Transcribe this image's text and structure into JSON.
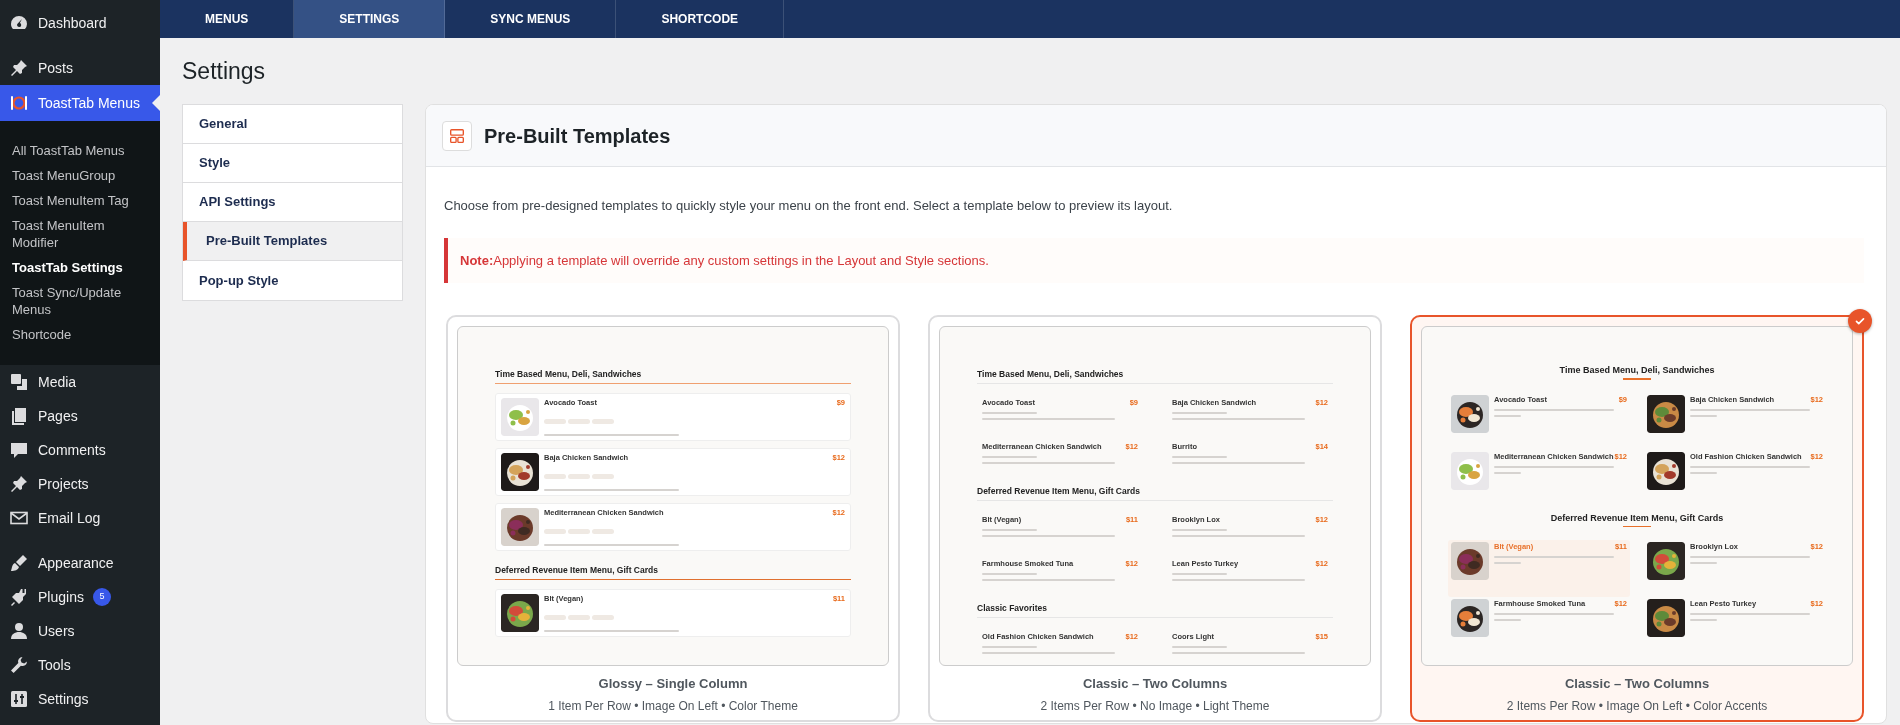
{
  "admin_menu": {
    "groups": [
      [
        {
          "label": "Dashboard",
          "selected": false
        }
      ],
      [
        {
          "label": "Posts",
          "selected": false
        },
        {
          "label": "ToastTab Menus",
          "selected": true,
          "submenu": [
            {
              "label": "All ToastTab Menus",
              "selected": false
            },
            {
              "label": "Toast MenuGroup",
              "selected": false
            },
            {
              "label": "Toast MenuItem Tag",
              "selected": false
            },
            {
              "label": "Toast MenuItem Modifier",
              "selected": false
            },
            {
              "label": "ToastTab Settings",
              "selected": true
            },
            {
              "label": "Toast Sync/Update Menus",
              "selected": false
            },
            {
              "label": "Shortcode",
              "selected": false
            }
          ]
        },
        {
          "label": "Media",
          "selected": false
        },
        {
          "label": "Pages",
          "selected": false
        },
        {
          "label": "Comments",
          "selected": false
        },
        {
          "label": "Projects",
          "selected": false
        },
        {
          "label": "Email Log",
          "selected": false
        }
      ],
      [
        {
          "label": "Appearance",
          "selected": false
        },
        {
          "label": "Plugins",
          "selected": false,
          "badge": "5"
        },
        {
          "label": "Users",
          "selected": false
        },
        {
          "label": "Tools",
          "selected": false
        },
        {
          "label": "Settings",
          "selected": false
        }
      ]
    ]
  },
  "top_tabs": [
    {
      "label": "MENUS",
      "selected": false
    },
    {
      "label": "SETTINGS",
      "selected": true
    },
    {
      "label": "SYNC MENUS",
      "selected": false
    },
    {
      "label": "SHORTCODE",
      "selected": false
    }
  ],
  "page_title": "Settings",
  "settings_nav": [
    {
      "label": "General",
      "selected": false
    },
    {
      "label": "Style",
      "selected": false
    },
    {
      "label": "API Settings",
      "selected": false
    },
    {
      "label": "Pre-Built Templates",
      "selected": true
    },
    {
      "label": "Pop-up Style",
      "selected": false
    }
  ],
  "panel": {
    "title": "Pre-Built Templates",
    "description": "Choose from pre-designed templates to quickly style your menu on the front end. Select a template below to preview its layout.",
    "note": {
      "label": "Note:",
      "text": "Applying a template will override any custom settings in the Layout and Style sections."
    }
  },
  "templates": [
    {
      "title": "Glossy – Single Column",
      "subtitle": "1 Item Per Row • Image On Left • Color Theme",
      "selected": false,
      "preview": {
        "kind": "cards",
        "sections": [
          {
            "heading": "Time Based Menu, Deli, Sandwiches",
            "items": [
              {
                "name": "Avocado Toast",
                "price": "$9"
              },
              {
                "name": "Baja Chicken Sandwich",
                "price": "$12"
              },
              {
                "name": "Mediterranean Chicken Sandwich",
                "price": "$12"
              }
            ]
          },
          {
            "heading": "Deferred Revenue Item Menu, Gift Cards",
            "items": [
              {
                "name": "Blt (Vegan)",
                "price": "$11"
              }
            ]
          }
        ]
      }
    },
    {
      "title": "Classic – Two Columns",
      "subtitle": "2 Items Per Row • No Image • Light Theme",
      "selected": false,
      "preview": {
        "kind": "columns",
        "sections": [
          {
            "heading": "Time Based Menu, Deli, Sandwiches",
            "items": [
              {
                "name": "Avocado Toast",
                "price": "$9"
              },
              {
                "name": "Baja Chicken Sandwich",
                "price": "$12"
              },
              {
                "name": "Mediterranean Chicken Sandwich",
                "price": "$12"
              },
              {
                "name": "Burrito",
                "price": "$14"
              }
            ]
          },
          {
            "heading": "Deferred Revenue Item Menu, Gift Cards",
            "items": [
              {
                "name": "Blt (Vegan)",
                "price": "$11"
              },
              {
                "name": "Brooklyn Lox",
                "price": "$12"
              },
              {
                "name": "Farmhouse Smoked Tuna",
                "price": "$12"
              },
              {
                "name": "Lean Pesto Turkey",
                "price": "$12"
              }
            ]
          },
          {
            "heading": "Classic Favorites",
            "items": [
              {
                "name": "Old Fashion Chicken Sandwich",
                "price": "$12"
              },
              {
                "name": "Coors Light",
                "price": "$15"
              }
            ]
          }
        ]
      }
    },
    {
      "title": "Classic – Two Columns",
      "subtitle": "2 Items Per Row • Image On Left • Color Accents",
      "selected": true,
      "preview": {
        "kind": "image_columns",
        "sections": [
          {
            "heading": "Time Based Menu, Deli, Sandwiches",
            "items": [
              {
                "name": "Avocado Toast",
                "price": "$9",
                "highlighted": false
              },
              {
                "name": "Baja Chicken Sandwich",
                "price": "$12",
                "highlighted": false
              },
              {
                "name": "Mediterranean Chicken Sandwich",
                "price": "$12",
                "highlighted": false
              },
              {
                "name": "Old Fashion Chicken Sandwich",
                "price": "$12",
                "highlighted": false
              }
            ]
          },
          {
            "heading": "Deferred Revenue Item Menu, Gift Cards",
            "items": [
              {
                "name": "Blt (Vegan)",
                "price": "$11",
                "highlighted": true
              },
              {
                "name": "Brooklyn Lox",
                "price": "$12",
                "highlighted": false
              },
              {
                "name": "Farmhouse Smoked Tuna",
                "price": "$12",
                "highlighted": false
              },
              {
                "name": "Lean Pesto Turkey",
                "price": "$12",
                "highlighted": false
              }
            ]
          }
        ]
      }
    }
  ]
}
